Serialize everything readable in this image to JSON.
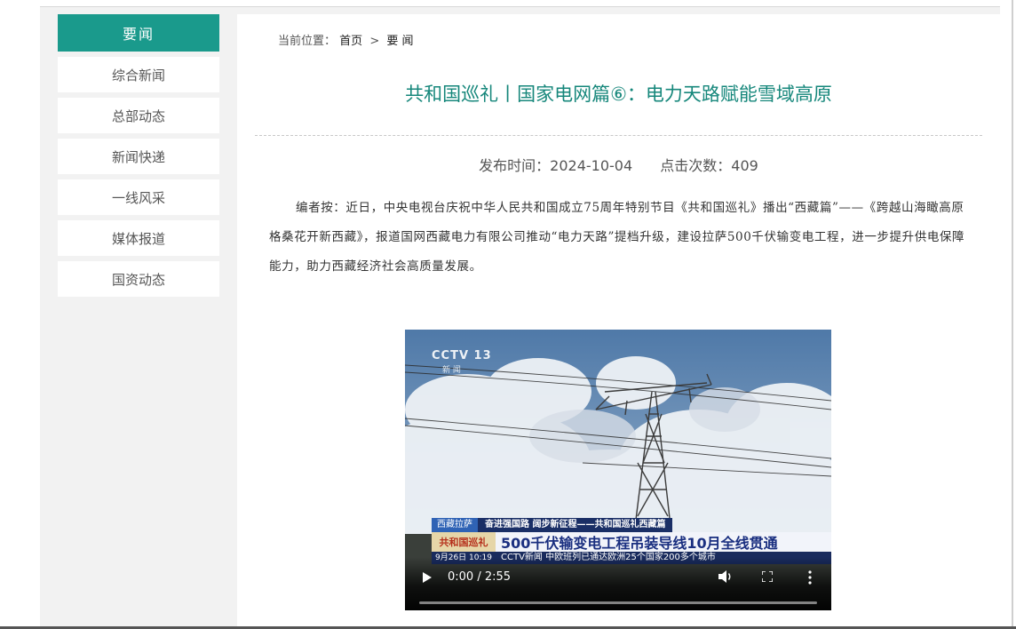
{
  "sidebar": {
    "header": "要闻",
    "items": [
      {
        "label": "综合新闻"
      },
      {
        "label": "总部动态"
      },
      {
        "label": "新闻快递"
      },
      {
        "label": "一线风采"
      },
      {
        "label": "媒体报道"
      },
      {
        "label": "国资动态"
      }
    ]
  },
  "breadcrumb": {
    "prefix": "当前位置：",
    "home": "首页",
    "separator": ">",
    "current": "要 闻"
  },
  "article": {
    "title": "共和国巡礼丨国家电网篇⑥：电力天路赋能雪域高原",
    "publish_time": "发布时间：2024-10-04",
    "views": "点击次数：409",
    "intro": "编者按：近日，中央电视台庆祝中华人民共和国成立75周年特别节目《共和国巡礼》播出“西藏篇”——《跨越山海瞰高原 格桑花开新西藏》，报道国网西藏电力有限公司推动“电力天路”提档升级，建设拉萨500千伏输变电工程，进一步提升供电保障能力，助力西藏经济社会高质量发展。"
  },
  "video": {
    "channel_logo": "CCTV 13",
    "channel_sub": "新 闻",
    "location": "西藏拉萨",
    "topic": "奋进强国路 阔步新征程——共和国巡礼西藏篇",
    "badge": "共和国巡礼",
    "headline": "500千伏输变电工程吊装导线10月全线贯通",
    "timestamp": "9月26日 10:19",
    "ticker": "CCTV新闻  中欧班列已通达欧洲25个国家200多个城市",
    "time_display": "0:00 / 2:55",
    "progress": 0.0
  },
  "colors": {
    "accent": "#1a9a8c",
    "title": "#16877b",
    "page_bg": "#f2f2f2"
  }
}
